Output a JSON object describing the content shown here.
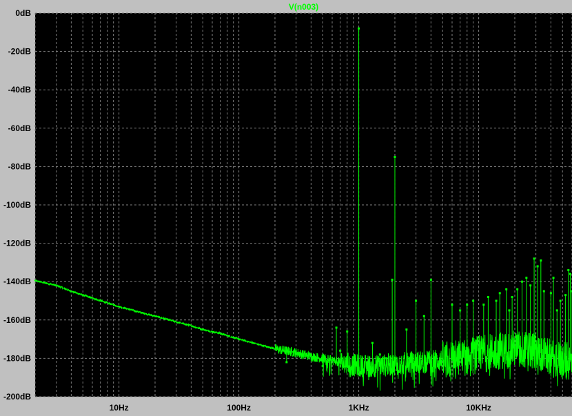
{
  "colors": {
    "window_bg": "#c0c0c0",
    "plot_bg": "#000000",
    "grid": "#808080",
    "trace": "#00ff00",
    "label": "#000000"
  },
  "chart_data": {
    "type": "line",
    "title": "V(n003)",
    "xscale": "log",
    "xlim": [
      2,
      60000
    ],
    "ylim": [
      -200,
      0
    ],
    "grid": true,
    "ylabel": "",
    "xlabel": "",
    "y_ticks": [
      {
        "value": 0,
        "label": "0dB"
      },
      {
        "value": -20,
        "label": "-20dB"
      },
      {
        "value": -40,
        "label": "-40dB"
      },
      {
        "value": -60,
        "label": "-60dB"
      },
      {
        "value": -80,
        "label": "-80dB"
      },
      {
        "value": -100,
        "label": "-100dB"
      },
      {
        "value": -120,
        "label": "-120dB"
      },
      {
        "value": -140,
        "label": "-140dB"
      },
      {
        "value": -160,
        "label": "-160dB"
      },
      {
        "value": -180,
        "label": "-180dB"
      },
      {
        "value": -200,
        "label": "-200dB"
      }
    ],
    "x_ticks": [
      {
        "value": 10,
        "label": "10Hz"
      },
      {
        "value": 100,
        "label": "100Hz"
      },
      {
        "value": 1000,
        "label": "1KHz"
      },
      {
        "value": 10000,
        "label": "10KHz"
      }
    ],
    "series": [
      {
        "name": "V(n003)",
        "noise_floor": [
          [
            2,
            -139.5
          ],
          [
            3,
            -142
          ],
          [
            4,
            -145
          ],
          [
            5,
            -147
          ],
          [
            7,
            -150
          ],
          [
            10,
            -153
          ],
          [
            15,
            -156
          ],
          [
            20,
            -158
          ],
          [
            30,
            -161
          ],
          [
            40,
            -163
          ],
          [
            50,
            -165
          ],
          [
            70,
            -167
          ],
          [
            100,
            -170
          ],
          [
            150,
            -173
          ],
          [
            200,
            -175
          ],
          [
            300,
            -177
          ],
          [
            400,
            -179
          ],
          [
            500,
            -180
          ],
          [
            700,
            -182
          ],
          [
            1000,
            -184
          ],
          [
            1500,
            -184
          ],
          [
            2000,
            -183
          ],
          [
            3000,
            -182
          ],
          [
            5000,
            -181
          ],
          [
            7000,
            -180
          ],
          [
            10000,
            -178
          ],
          [
            15000,
            -176
          ],
          [
            20000,
            -175
          ],
          [
            30000,
            -176
          ],
          [
            40000,
            -180
          ],
          [
            60000,
            -182
          ]
        ],
        "peaks": [
          [
            1000,
            -8
          ],
          [
            2000,
            -75
          ],
          [
            1900,
            -139
          ],
          [
            3000,
            -150
          ],
          [
            4000,
            -139
          ],
          [
            3500,
            -158
          ],
          [
            6000,
            -152
          ],
          [
            7000,
            -155
          ],
          [
            8000,
            -152
          ],
          [
            9000,
            -150
          ],
          [
            11000,
            -152
          ],
          [
            12000,
            -148
          ],
          [
            14000,
            -150
          ],
          [
            15000,
            -146
          ],
          [
            17000,
            -144
          ],
          [
            19000,
            -148
          ],
          [
            21000,
            -144
          ],
          [
            23000,
            -140
          ],
          [
            25000,
            -138
          ],
          [
            27000,
            -142
          ],
          [
            29000,
            -128
          ],
          [
            31000,
            -132
          ],
          [
            33000,
            -129
          ],
          [
            35000,
            -145
          ],
          [
            40000,
            -146
          ],
          [
            42000,
            -138
          ],
          [
            48000,
            -150
          ],
          [
            53000,
            -147
          ],
          [
            56000,
            -134
          ],
          [
            58000,
            -136
          ],
          [
            60000,
            -145
          ],
          [
            800,
            -166
          ],
          [
            700,
            -176
          ],
          [
            650,
            -164
          ],
          [
            500,
            -184
          ],
          [
            400,
            -178
          ],
          [
            250,
            -182
          ],
          [
            1300,
            -172
          ],
          [
            1500,
            -178
          ],
          [
            1700,
            -180
          ],
          [
            2500,
            -165
          ],
          [
            18000,
            -155
          ],
          [
            45000,
            -155
          ]
        ]
      }
    ]
  }
}
